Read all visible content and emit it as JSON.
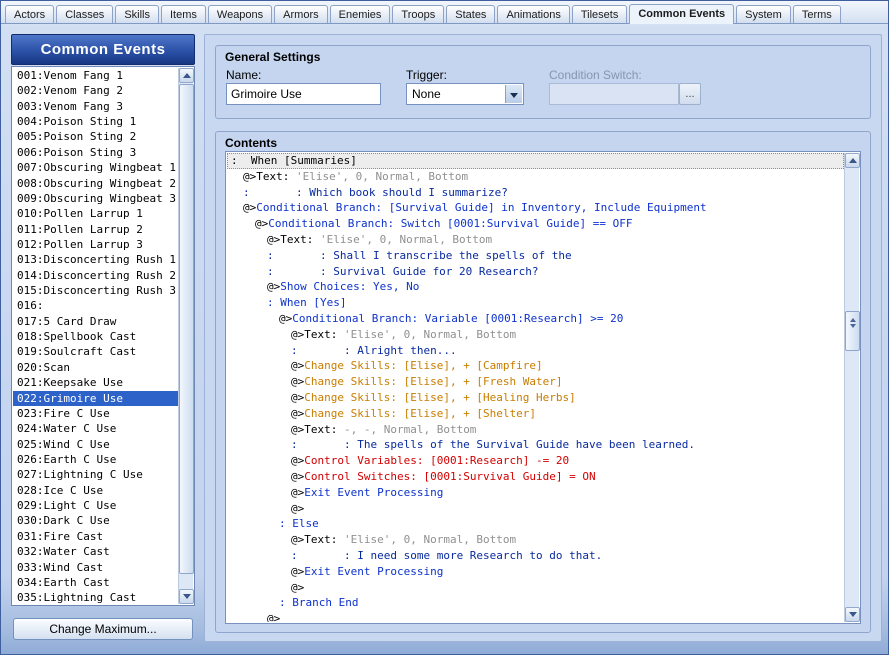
{
  "tabs": {
    "items": [
      "Actors",
      "Classes",
      "Skills",
      "Items",
      "Weapons",
      "Armors",
      "Enemies",
      "Troops",
      "States",
      "Animations",
      "Tilesets",
      "Common Events",
      "System",
      "Terms"
    ],
    "active": "Common Events"
  },
  "sidebar": {
    "title": "Common Events",
    "selected_index": 21,
    "items": [
      "001:Venom Fang 1",
      "002:Venom Fang 2",
      "003:Venom Fang 3",
      "004:Poison Sting 1",
      "005:Poison Sting 2",
      "006:Poison Sting 3",
      "007:Obscuring Wingbeat 1",
      "008:Obscuring Wingbeat 2",
      "009:Obscuring Wingbeat 3",
      "010:Pollen Larrup 1",
      "011:Pollen Larrup 2",
      "012:Pollen Larrup 3",
      "013:Disconcerting Rush 1",
      "014:Disconcerting Rush 2",
      "015:Disconcerting Rush 3",
      "016:",
      "017:5 Card Draw",
      "018:Spellbook Cast",
      "019:Soulcraft Cast",
      "020:Scan",
      "021:Keepsake Use",
      "022:Grimoire Use",
      "023:Fire C Use",
      "024:Water C Use",
      "025:Wind C Use",
      "026:Earth C Use",
      "027:Lightning C Use",
      "028:Ice C Use",
      "029:Light C Use",
      "030:Dark C Use",
      "031:Fire Cast",
      "032:Water Cast",
      "033:Wind Cast",
      "034:Earth Cast",
      "035:Lightning Cast"
    ],
    "change_maximum_label": "Change Maximum..."
  },
  "general_settings": {
    "title": "General Settings",
    "name": {
      "label": "Name:",
      "value": "Grimoire Use"
    },
    "trigger": {
      "label": "Trigger:",
      "value": "None"
    },
    "condition_switch": {
      "label": "Condition Switch:",
      "value": "",
      "browse_label": "..."
    }
  },
  "contents": {
    "title": "Contents",
    "colors": {
      "k": "#000000",
      "g": "#909090",
      "b": "#0d32cc",
      "n": "#082a9e",
      "o": "#c87d00",
      "r": "#d40000"
    },
    "lines": [
      {
        "indent": 0,
        "parts": [
          {
            "t": ":  When [Summaries]",
            "c": "k"
          }
        ]
      },
      {
        "indent": 1,
        "parts": [
          {
            "t": "@>Text:",
            "c": "k"
          },
          {
            "t": " 'Elise', 0, Normal, Bottom",
            "c": "g"
          }
        ]
      },
      {
        "indent": 1,
        "parts": [
          {
            "t": ":       : Which book should I summarize?",
            "c": "n"
          }
        ]
      },
      {
        "indent": 1,
        "parts": [
          {
            "t": "@>",
            "c": "k"
          },
          {
            "t": "Conditional Branch: [Survival Guide] in Inventory, Include Equipment",
            "c": "b"
          }
        ]
      },
      {
        "indent": 2,
        "parts": [
          {
            "t": "@>",
            "c": "k"
          },
          {
            "t": "Conditional Branch: Switch [0001:Survival Guide] == OFF",
            "c": "b"
          }
        ]
      },
      {
        "indent": 3,
        "parts": [
          {
            "t": "@>Text:",
            "c": "k"
          },
          {
            "t": " 'Elise', 0, Normal, Bottom",
            "c": "g"
          }
        ]
      },
      {
        "indent": 3,
        "parts": [
          {
            "t": ":       : Shall I transcribe the spells of the",
            "c": "n"
          }
        ]
      },
      {
        "indent": 3,
        "parts": [
          {
            "t": ":       : Survival Guide for 20 Research?",
            "c": "n"
          }
        ]
      },
      {
        "indent": 3,
        "parts": [
          {
            "t": "@>",
            "c": "k"
          },
          {
            "t": "Show Choices: Yes, No",
            "c": "b"
          }
        ]
      },
      {
        "indent": 3,
        "parts": [
          {
            "t": ": When [Yes]",
            "c": "b"
          }
        ]
      },
      {
        "indent": 4,
        "parts": [
          {
            "t": "@>",
            "c": "k"
          },
          {
            "t": "Conditional Branch: Variable [0001:Research] >= 20",
            "c": "b"
          }
        ]
      },
      {
        "indent": 5,
        "parts": [
          {
            "t": "@>Text:",
            "c": "k"
          },
          {
            "t": " 'Elise', 0, Normal, Bottom",
            "c": "g"
          }
        ]
      },
      {
        "indent": 5,
        "parts": [
          {
            "t": ":       : Alright then...",
            "c": "n"
          }
        ]
      },
      {
        "indent": 5,
        "parts": [
          {
            "t": "@>",
            "c": "k"
          },
          {
            "t": "Change Skills: [Elise], + [Campfire]",
            "c": "o"
          }
        ]
      },
      {
        "indent": 5,
        "parts": [
          {
            "t": "@>",
            "c": "k"
          },
          {
            "t": "Change Skills: [Elise], + [Fresh Water]",
            "c": "o"
          }
        ]
      },
      {
        "indent": 5,
        "parts": [
          {
            "t": "@>",
            "c": "k"
          },
          {
            "t": "Change Skills: [Elise], + [Healing Herbs]",
            "c": "o"
          }
        ]
      },
      {
        "indent": 5,
        "parts": [
          {
            "t": "@>",
            "c": "k"
          },
          {
            "t": "Change Skills: [Elise], + [Shelter]",
            "c": "o"
          }
        ]
      },
      {
        "indent": 5,
        "parts": [
          {
            "t": "@>Text:",
            "c": "k"
          },
          {
            "t": " -, -, Normal, Bottom",
            "c": "g"
          }
        ]
      },
      {
        "indent": 5,
        "parts": [
          {
            "t": ":       : The spells of the Survival Guide have been learned.",
            "c": "n"
          }
        ]
      },
      {
        "indent": 5,
        "parts": [
          {
            "t": "@>",
            "c": "k"
          },
          {
            "t": "Control Variables: [0001:Research] -= 20",
            "c": "r"
          }
        ]
      },
      {
        "indent": 5,
        "parts": [
          {
            "t": "@>",
            "c": "k"
          },
          {
            "t": "Control Switches: [0001:Survival Guide] = ON",
            "c": "r"
          }
        ]
      },
      {
        "indent": 5,
        "parts": [
          {
            "t": "@>",
            "c": "k"
          },
          {
            "t": "Exit Event Processing",
            "c": "b"
          }
        ]
      },
      {
        "indent": 5,
        "parts": [
          {
            "t": "@>",
            "c": "k"
          }
        ]
      },
      {
        "indent": 4,
        "parts": [
          {
            "t": ": Else",
            "c": "b"
          }
        ]
      },
      {
        "indent": 5,
        "parts": [
          {
            "t": "@>Text:",
            "c": "k"
          },
          {
            "t": " 'Elise', 0, Normal, Bottom",
            "c": "g"
          }
        ]
      },
      {
        "indent": 5,
        "parts": [
          {
            "t": ":       : I need some more Research to do that.",
            "c": "n"
          }
        ]
      },
      {
        "indent": 5,
        "parts": [
          {
            "t": "@>",
            "c": "k"
          },
          {
            "t": "Exit Event Processing",
            "c": "b"
          }
        ]
      },
      {
        "indent": 5,
        "parts": [
          {
            "t": "@>",
            "c": "k"
          }
        ]
      },
      {
        "indent": 4,
        "parts": [
          {
            "t": ": Branch End",
            "c": "b"
          }
        ]
      },
      {
        "indent": 3,
        "parts": [
          {
            "t": "@>",
            "c": "k"
          }
        ]
      }
    ]
  }
}
